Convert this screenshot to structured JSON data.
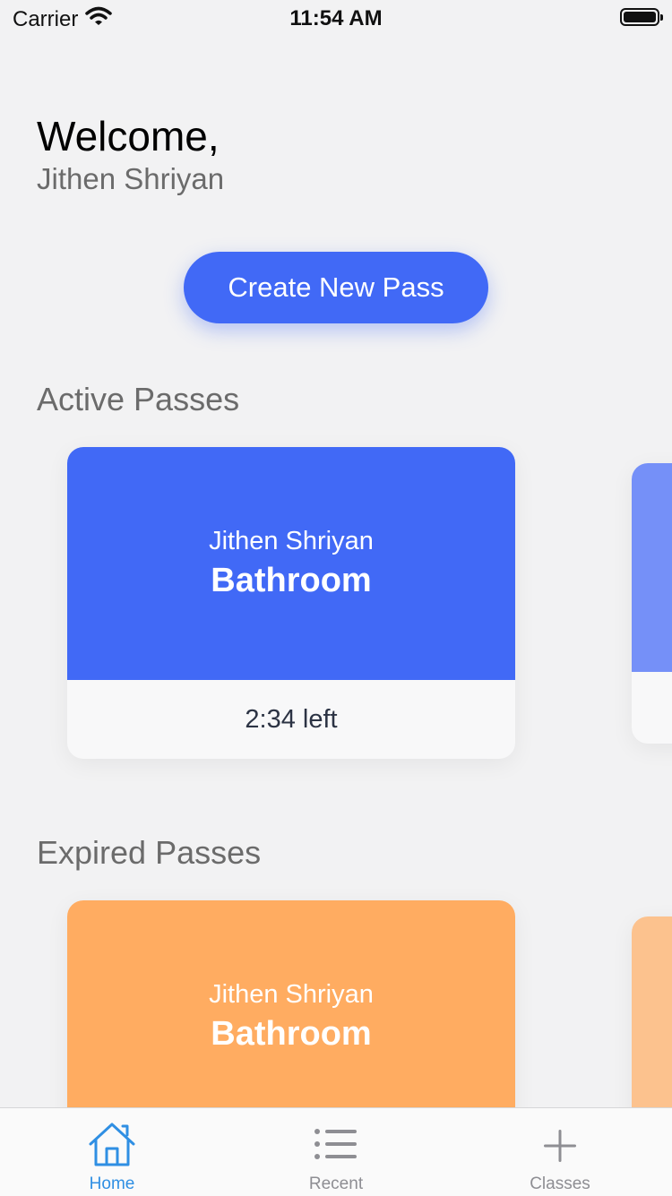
{
  "status_bar": {
    "carrier": "Carrier",
    "time": "11:54 AM"
  },
  "header": {
    "welcome": "Welcome,",
    "user_name": "Jithen Shriyan"
  },
  "create_button": {
    "label": "Create New Pass"
  },
  "active_section": {
    "title": "Active Passes",
    "cards": [
      {
        "name": "Jithen Shriyan",
        "destination": "Bathroom",
        "time_left": "2:34 left",
        "color": "#4169f6"
      }
    ],
    "peek_color": "#7590f8"
  },
  "expired_section": {
    "title": "Expired Passes",
    "cards": [
      {
        "name": "Jithen Shriyan",
        "destination": "Bathroom",
        "color": "#ffac61"
      }
    ],
    "peek_color": "#fcc28e"
  },
  "tab_bar": {
    "tabs": [
      {
        "label": "Home",
        "icon": "home-icon",
        "active": true
      },
      {
        "label": "Recent",
        "icon": "list-icon",
        "active": false
      },
      {
        "label": "Classes",
        "icon": "plus-icon",
        "active": false
      }
    ],
    "active_color": "#2f8fe3",
    "inactive_color": "#8e8e93"
  }
}
